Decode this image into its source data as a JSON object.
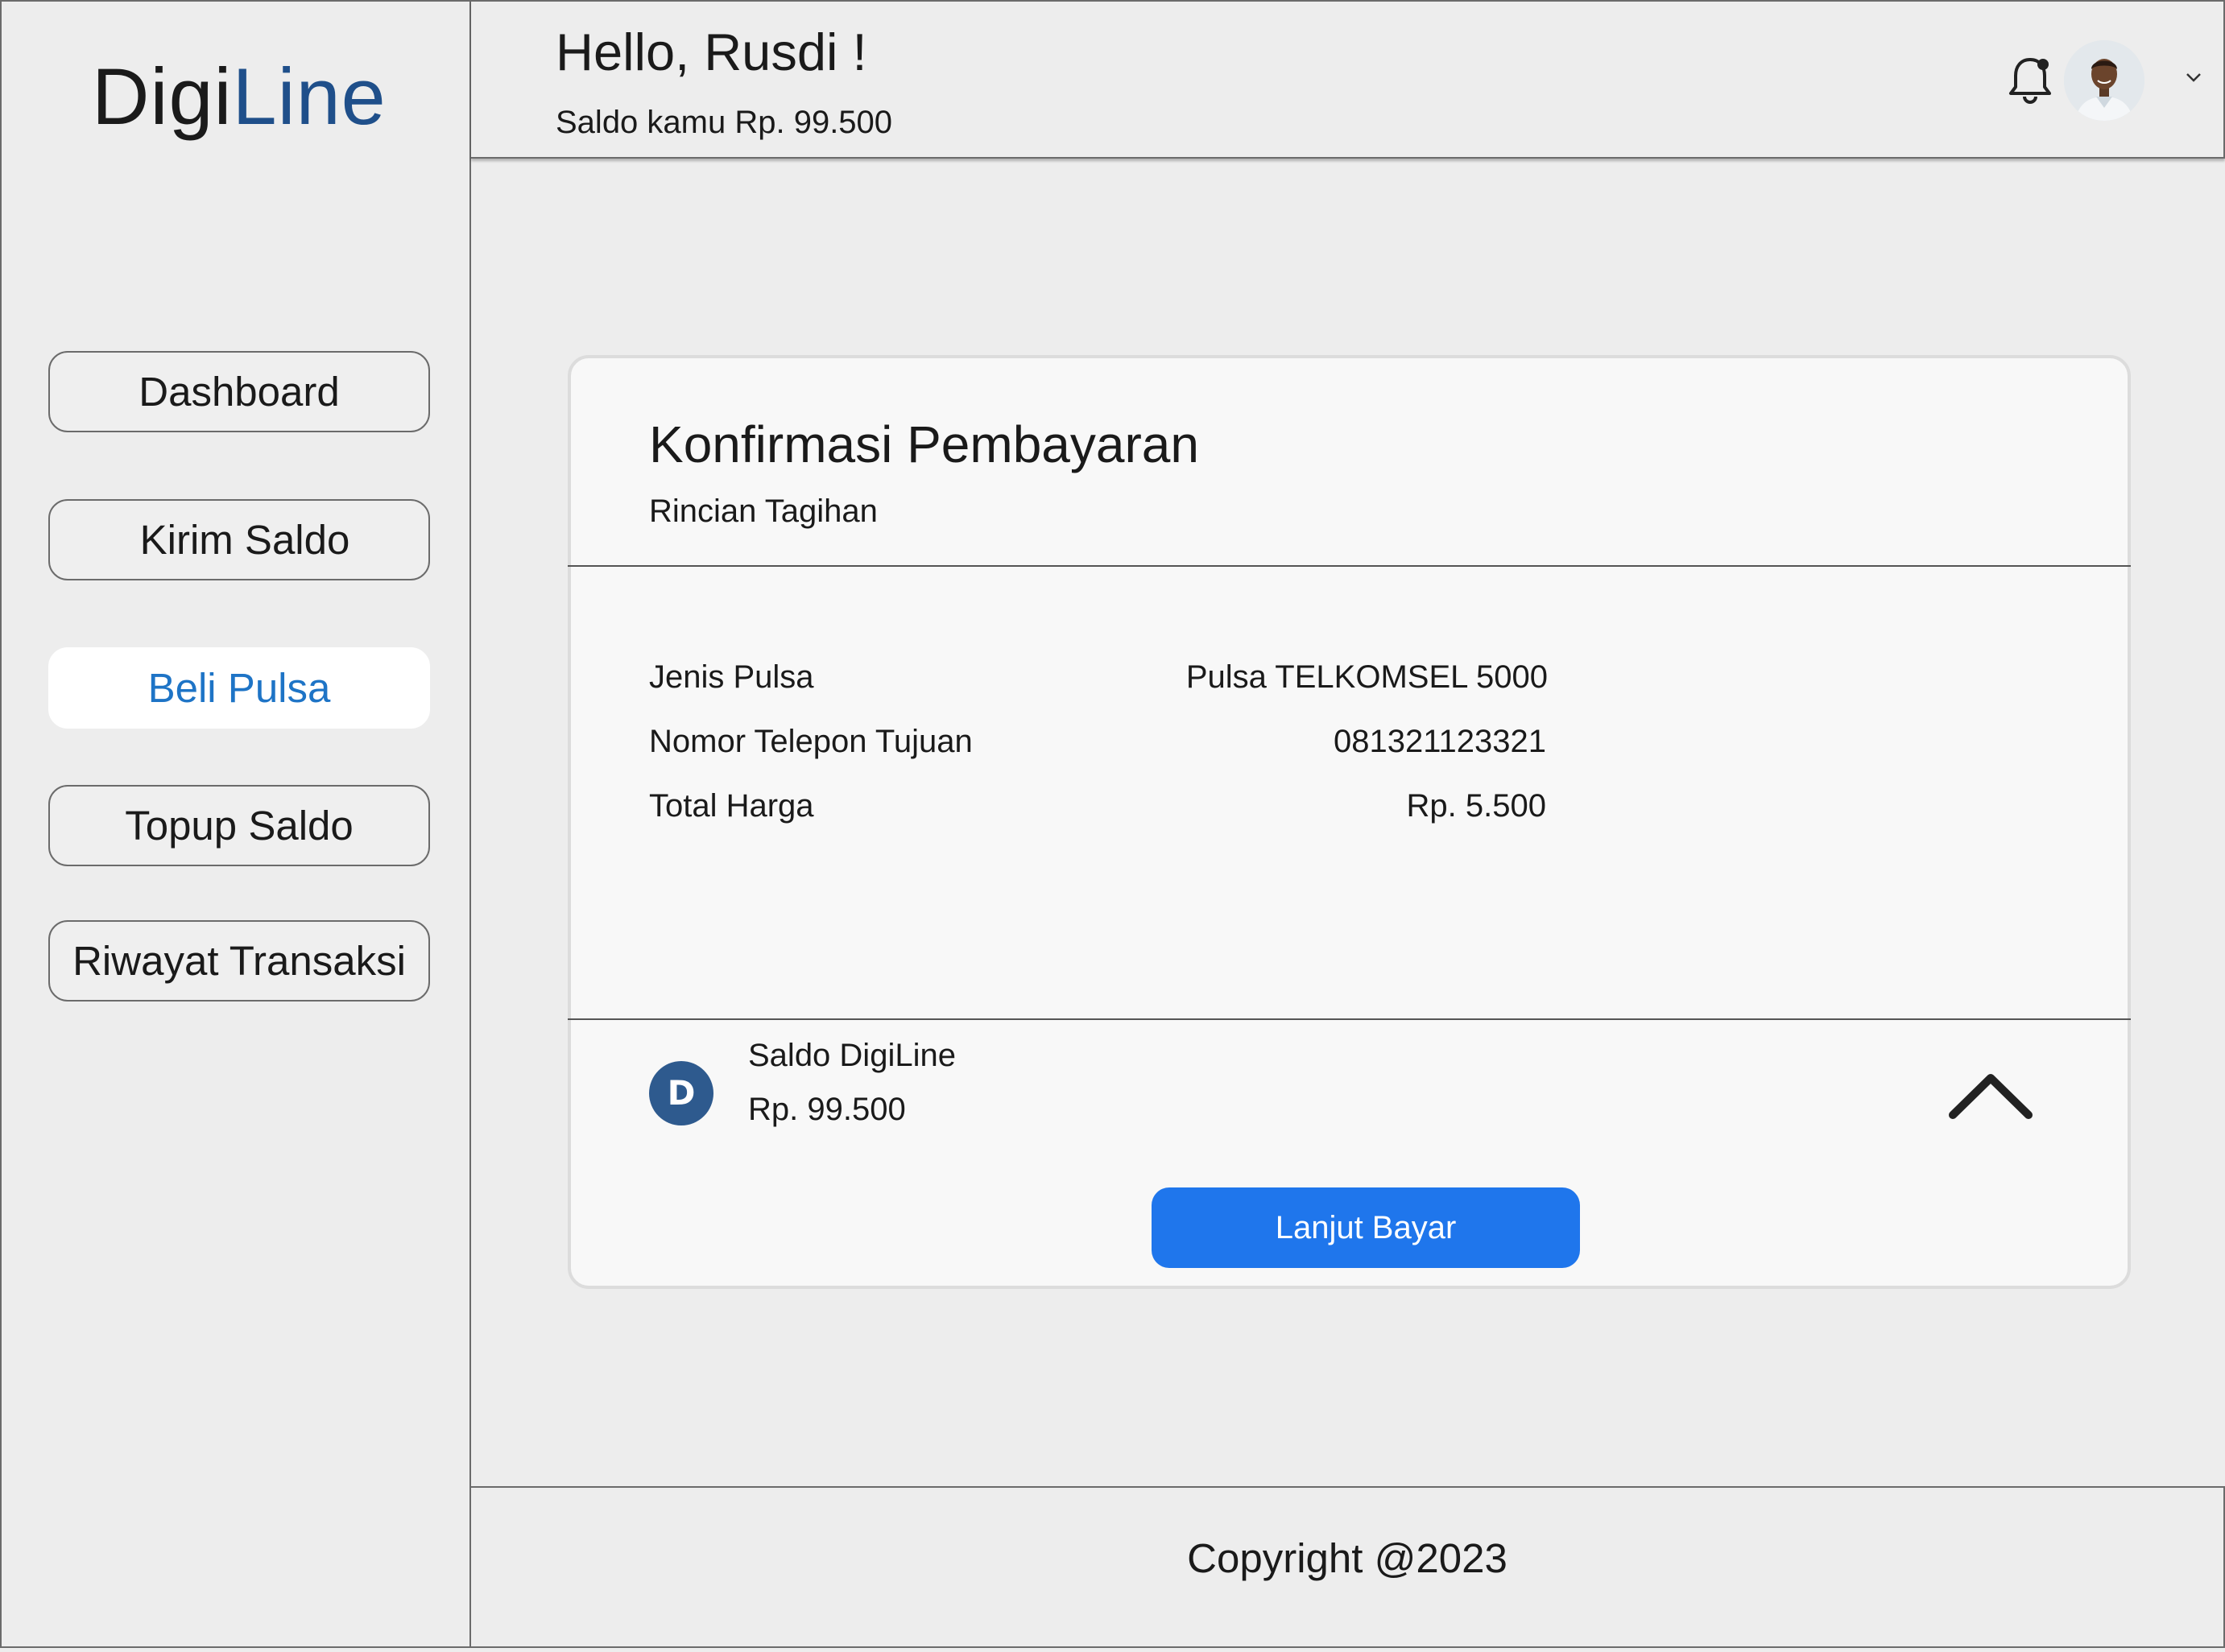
{
  "brand": {
    "logo_part1": "Digi",
    "logo_part2": "Line",
    "accent_color": "#1f4f8a"
  },
  "sidebar": {
    "items": [
      {
        "label": "Dashboard",
        "active": false
      },
      {
        "label": "Kirim Saldo",
        "active": false
      },
      {
        "label": "Beli Pulsa",
        "active": true
      },
      {
        "label": "Topup Saldo",
        "active": false
      },
      {
        "label": "Riwayat Transaksi",
        "active": false
      }
    ]
  },
  "header": {
    "greeting": "Hello, Rusdi !",
    "balance_text": "Saldo kamu Rp. 99.500",
    "notification_icon": "bell-icon",
    "avatar_icon": "user-avatar"
  },
  "card": {
    "title": "Konfirmasi Pembayaran",
    "subtitle": "Rincian Tagihan",
    "rows": [
      {
        "label": "Jenis Pulsa",
        "value": "Pulsa TELKOMSEL 5000"
      },
      {
        "label": "Nomor Telepon Tujuan",
        "value": "081321123321"
      },
      {
        "label": "Total Harga",
        "value": "Rp. 5.500"
      }
    ],
    "payment_method": {
      "icon_letter": "D",
      "name": "Saldo DigiLine",
      "amount": "Rp. 99.500"
    },
    "pay_button": "Lanjut Bayar",
    "primary_color": "#1f76ec"
  },
  "footer": {
    "copyright": "Copyright @2023"
  }
}
